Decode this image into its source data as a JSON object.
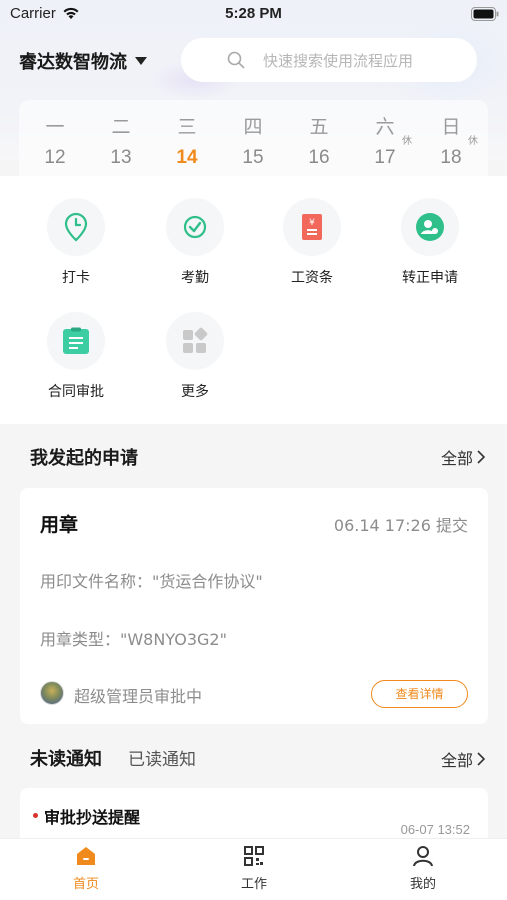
{
  "status_bar": {
    "carrier": "Carrier",
    "time": "5:28 PM"
  },
  "header": {
    "org_name": "睿达数智物流",
    "search_placeholder": "快速搜索使用流程应用"
  },
  "calendar": {
    "weekdays": [
      "一",
      "二",
      "三",
      "四",
      "五",
      "六",
      "日"
    ],
    "days": [
      "12",
      "13",
      "14",
      "15",
      "16",
      "17",
      "18"
    ],
    "active_index": 2,
    "rest_label": "休"
  },
  "apps": [
    {
      "label": "打卡",
      "icon": "clock-icon"
    },
    {
      "label": "考勤",
      "icon": "check-circle-icon"
    },
    {
      "label": "工资条",
      "icon": "salary-slip-icon"
    },
    {
      "label": "转正申请",
      "icon": "user-badge-icon"
    },
    {
      "label": "合同审批",
      "icon": "clipboard-icon"
    },
    {
      "label": "更多",
      "icon": "grid-more-icon"
    }
  ],
  "my_requests": {
    "title": "我发起的申请",
    "more": "全部",
    "card": {
      "title": "用章",
      "time": "06.14 17:26 提交",
      "line1": "用印文件名称：\"货运合作协议\"",
      "line2": "用章类型：\"W8NYO3G2\"",
      "approver": "超级管理员审批中",
      "detail_button": "查看详情"
    }
  },
  "notices": {
    "tab_unread": "未读通知",
    "tab_read": "已读通知",
    "more": "全部",
    "item": {
      "title": "审批抄送提醒",
      "time": "06-07 13:52"
    }
  },
  "tabbar": [
    {
      "label": "首页",
      "icon": "home-icon"
    },
    {
      "label": "工作",
      "icon": "work-grid-icon"
    },
    {
      "label": "我的",
      "icon": "profile-icon"
    }
  ],
  "colors": {
    "accent": "#f08a1c",
    "green": "#2fbf8a",
    "red": "#f2685a"
  }
}
